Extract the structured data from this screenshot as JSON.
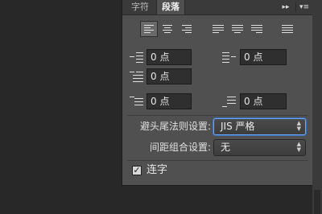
{
  "tabs": [
    {
      "label": "字符",
      "active": false
    },
    {
      "label": "段落",
      "active": true
    }
  ],
  "toolbar": {
    "collapse_glyph": "▸▸",
    "menu_glyph": "▾≡"
  },
  "alignment": [
    "left",
    "center",
    "right",
    "justify-last-left",
    "justify-last-center",
    "justify-last-right",
    "justify-all"
  ],
  "fields": {
    "left_indent": "0 点",
    "right_indent": "0 点",
    "first_line_indent": "0 点",
    "space_before": "0 点",
    "space_after": "0 点"
  },
  "kinsoku": {
    "label": "避头尾法则设置:",
    "value": "JIS 严格"
  },
  "mojikumi": {
    "label": "间距组合设置:",
    "value": "无"
  },
  "hyphenate": {
    "label": "连字",
    "checked": true
  }
}
